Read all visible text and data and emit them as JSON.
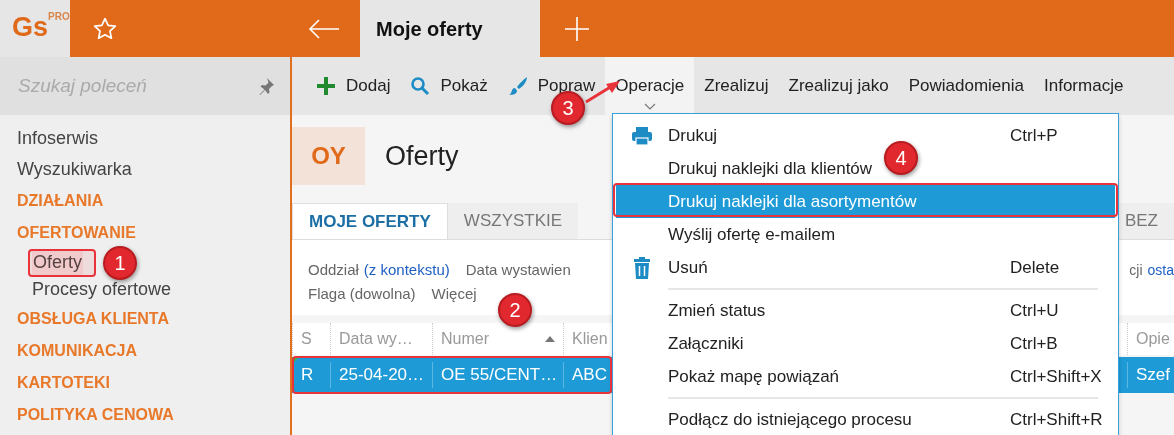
{
  "app": {
    "logo": "Gs",
    "edition": "PRO"
  },
  "tabs": [
    {
      "label": "Moje oferty",
      "selected": true
    }
  ],
  "sidebar": {
    "search": {
      "placeholder": "Szukaj poleceń"
    },
    "items": [
      {
        "label": "Infoserwis",
        "kind": "link",
        "selected": false
      },
      {
        "label": "Wyszukiwarka",
        "kind": "link",
        "selected": false
      },
      {
        "label": "DZIAŁANIA",
        "kind": "section",
        "selected": false
      },
      {
        "label": "OFERTOWANIE",
        "kind": "section",
        "selected": false,
        "children": [
          {
            "label": "Oferty",
            "kind": "link",
            "selected": true
          },
          {
            "label": "Procesy ofertowe",
            "kind": "link",
            "selected": false
          }
        ]
      },
      {
        "label": "OBSŁUGA KLIENTA",
        "kind": "section",
        "selected": false
      },
      {
        "label": "KOMUNIKACJA",
        "kind": "section",
        "selected": false
      },
      {
        "label": "KARTOTEKI",
        "kind": "section",
        "selected": false
      },
      {
        "label": "POLITYKA CENOWA",
        "kind": "section",
        "selected": false
      }
    ]
  },
  "toolbar": [
    {
      "label": "Dodaj",
      "kind": "add",
      "selected": false
    },
    {
      "label": "Pokaż",
      "kind": "search",
      "selected": false
    },
    {
      "label": "Popraw",
      "kind": "brush",
      "selected": false
    },
    {
      "label": "Operacje",
      "kind": "dropdown",
      "selected": true
    },
    {
      "label": "Zrealizuj",
      "kind": "plain",
      "selected": false
    },
    {
      "label": "Zrealizuj jako",
      "kind": "plain",
      "selected": false
    },
    {
      "label": "Powiadomienia",
      "kind": "plain",
      "selected": false
    },
    {
      "label": "Informacje",
      "kind": "plain",
      "selected": false
    }
  ],
  "page": {
    "badge": "OY",
    "title": "Oferty"
  },
  "view_tabs": [
    {
      "label": "MOJE OFERTY",
      "selected": true
    },
    {
      "label": "WSZYSTKIE",
      "selected": false
    },
    {
      "label": "BEZ",
      "selected": false
    }
  ],
  "filters": {
    "line_1": [
      {
        "label": "Oddział",
        "value": "(z kontekstu)"
      },
      {
        "label": "Data wystawien"
      }
    ],
    "line_1_right": [
      {
        "label": "cji",
        "value": "osta"
      }
    ],
    "line_2": [
      {
        "label": "Flaga (dowolna)"
      },
      {
        "label": "Więcej"
      }
    ]
  },
  "table": {
    "columns": [
      {
        "label": "S",
        "sorted": false
      },
      {
        "label": "Data wy…",
        "sorted": false
      },
      {
        "label": "Numer",
        "sorted": true
      },
      {
        "label": "Klien",
        "sorted": false
      },
      {
        "label": "Opie",
        "sorted": false
      }
    ],
    "rows": [
      {
        "cells": [
          "R",
          "25-04-20…",
          "OE 55/CENT…",
          "ABC",
          "Szef"
        ],
        "selected": true
      }
    ]
  },
  "menu": [
    {
      "label": "Drukuj",
      "shortcut": "Ctrl+P",
      "kind": "printer",
      "selected": false
    },
    {
      "label": "Drukuj naklejki dla klientów",
      "kind": "plain",
      "selected": false
    },
    {
      "label": "Drukuj naklejki dla asortymentów",
      "kind": "plain",
      "selected": true
    },
    {
      "label": "Wyślij ofertę e-mailem",
      "kind": "plain",
      "selected": false
    },
    {
      "label": "Usuń",
      "shortcut": "Delete",
      "kind": "trash",
      "selected": false
    },
    {
      "kind": "separator"
    },
    {
      "label": "Zmień status",
      "shortcut": "Ctrl+U",
      "kind": "plain",
      "selected": false
    },
    {
      "label": "Załączniki",
      "shortcut": "Ctrl+B",
      "kind": "plain",
      "selected": false
    },
    {
      "label": "Pokaż mapę powiązań",
      "shortcut": "Ctrl+Shift+X",
      "kind": "plain",
      "selected": false
    },
    {
      "kind": "separator"
    },
    {
      "label": "Podłącz do istniejącego procesu",
      "shortcut": "Ctrl+Shift+R",
      "kind": "plain",
      "selected": false
    }
  ],
  "annotations": [
    {
      "number": "1"
    },
    {
      "number": "2"
    },
    {
      "number": "3"
    },
    {
      "number": "4"
    }
  ]
}
